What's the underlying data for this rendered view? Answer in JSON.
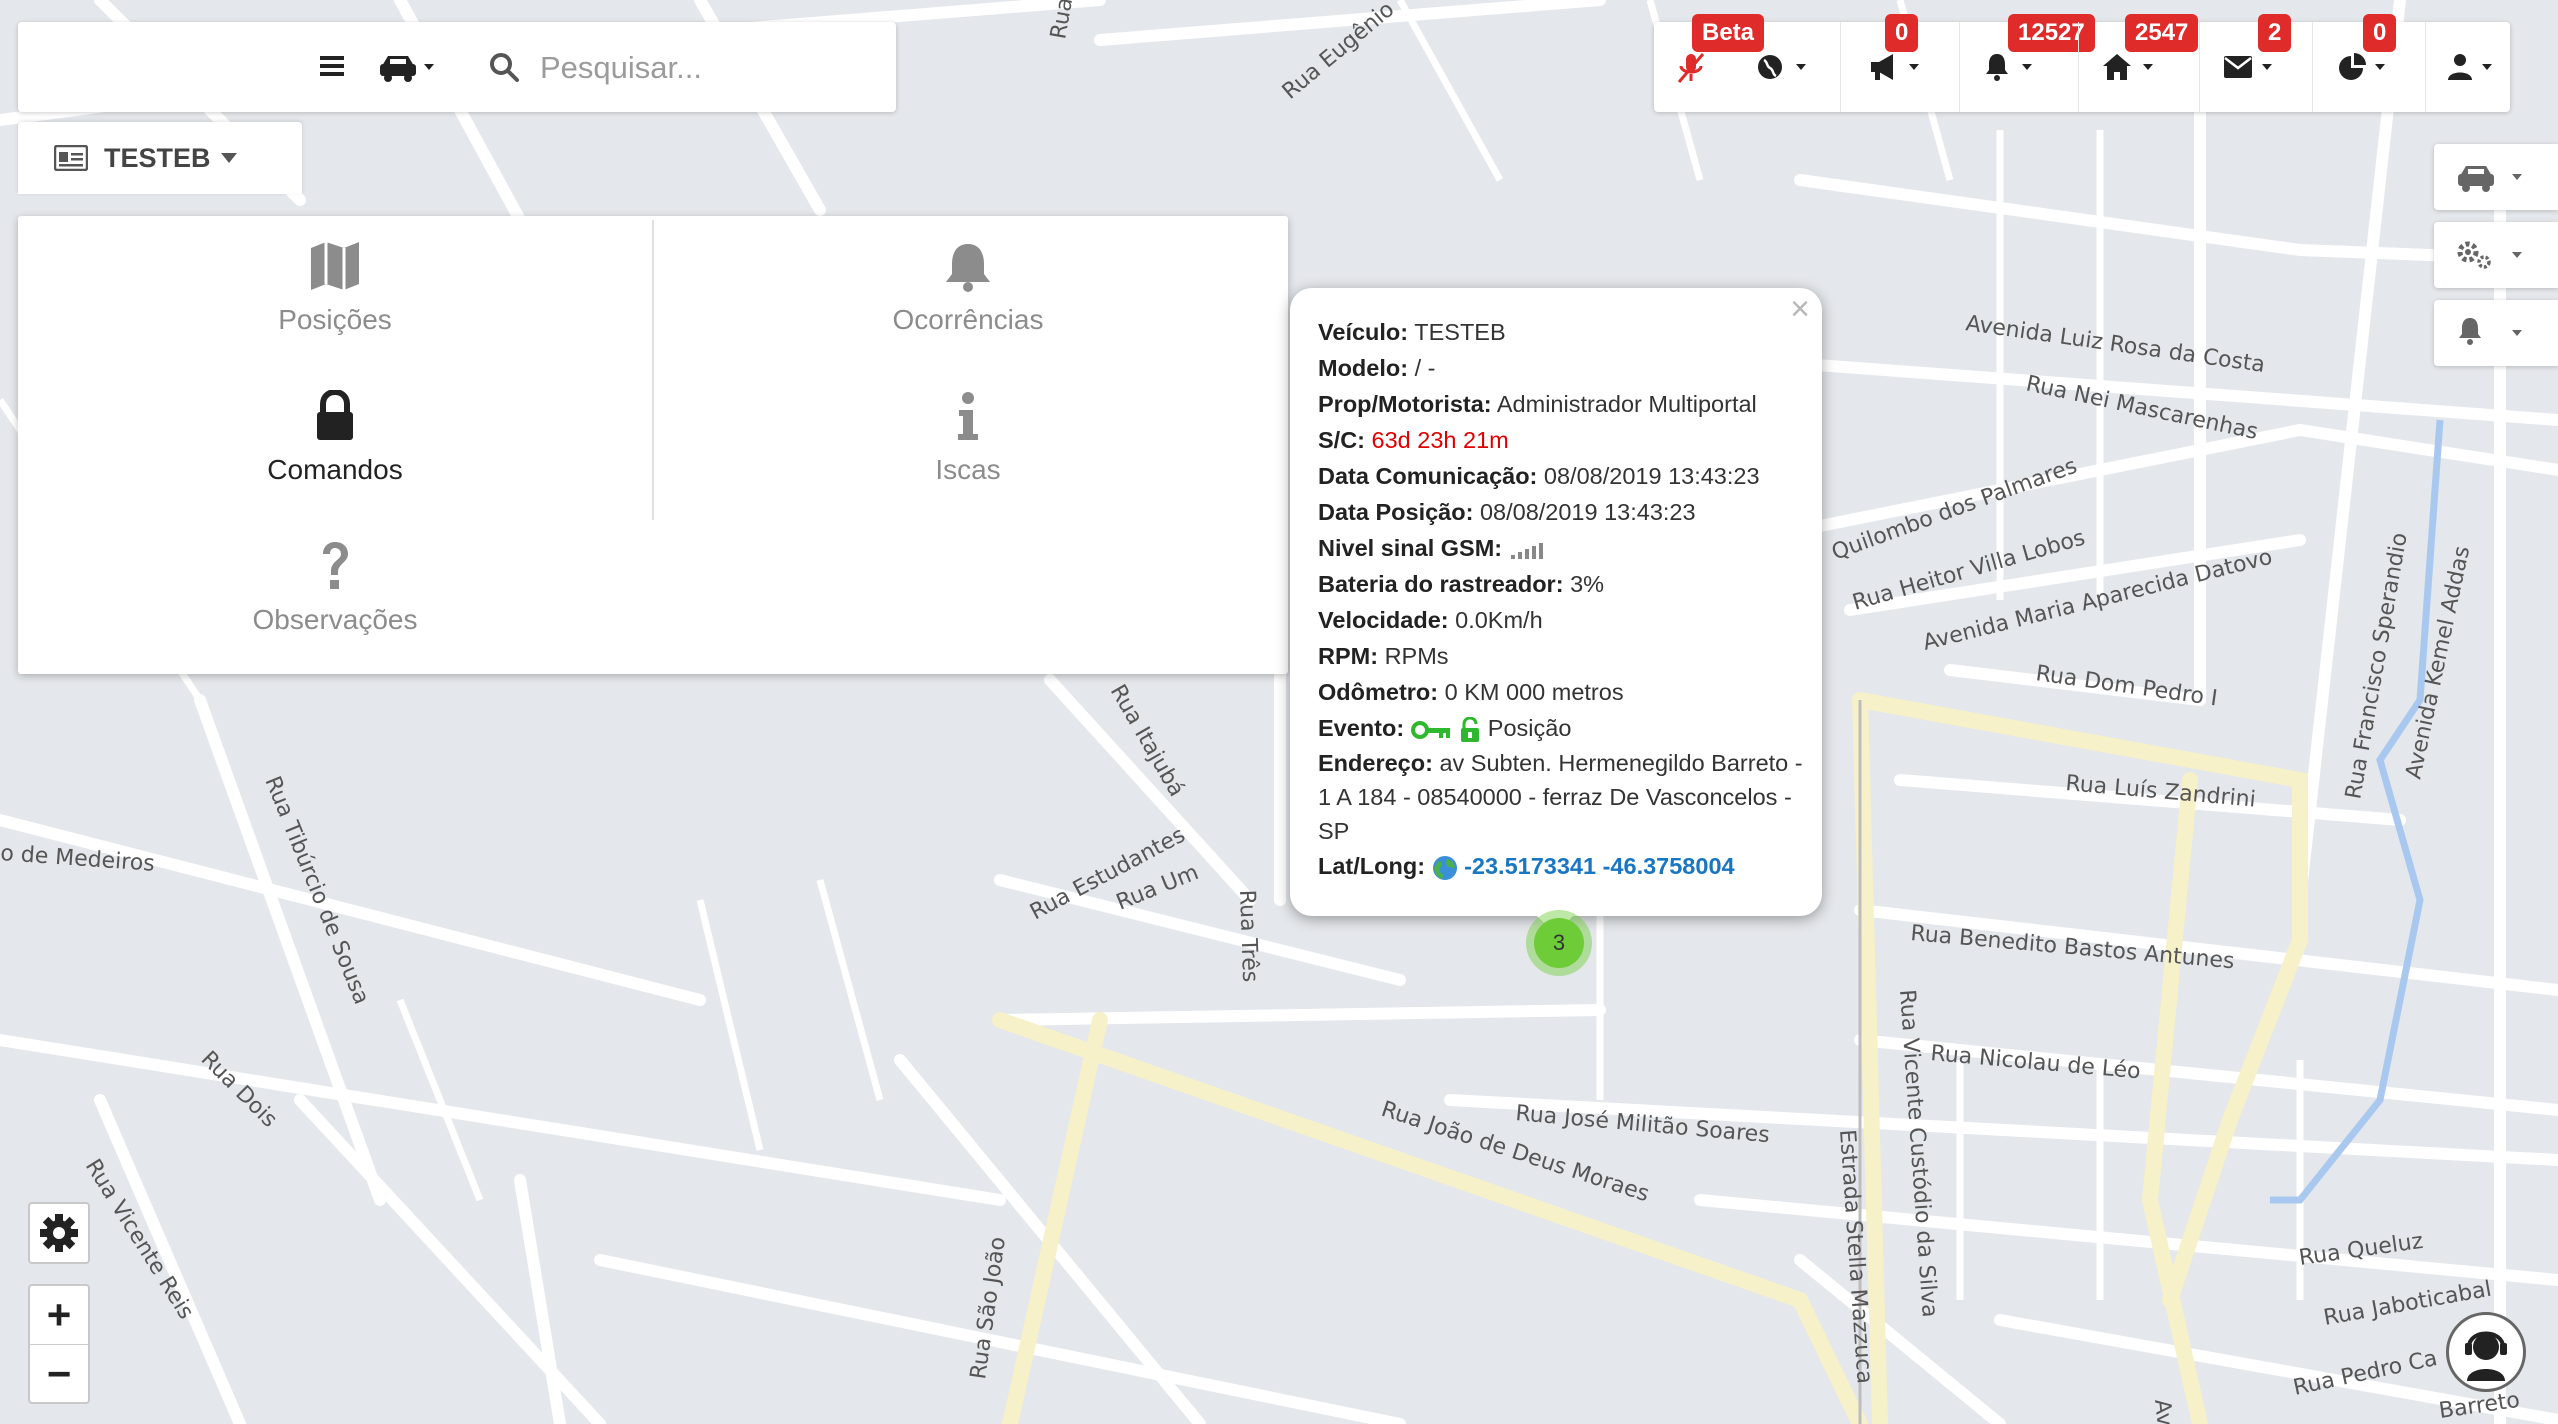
{
  "search": {
    "placeholder": "Pesquisar..."
  },
  "vehicle_tab": {
    "label": "TESTEB"
  },
  "panel": {
    "items": [
      {
        "label": "Posições",
        "icon": "map-icon"
      },
      {
        "label": "Ocorrências",
        "icon": "bell-icon"
      },
      {
        "label": "Comandos",
        "icon": "lock-icon",
        "active": true
      },
      {
        "label": "Iscas",
        "icon": "info-icon"
      },
      {
        "label": "Observações",
        "icon": "question-icon"
      }
    ]
  },
  "toolbar": {
    "beta": "Beta",
    "megaphone_count": "0",
    "alerts_count": "12527",
    "home_count": "2547",
    "mail_count": "2",
    "pie_count": "0"
  },
  "popup": {
    "veiculo_label": "Veículo:",
    "veiculo": "TESTEB",
    "modelo_label": "Modelo:",
    "modelo": "/ -",
    "prop_label": "Prop/Motorista:",
    "prop": "Administrador Multiportal",
    "sc_label": "S/C:",
    "sc": "63d 23h 21m",
    "data_com_label": "Data Comunicação:",
    "data_com": "08/08/2019 13:43:23",
    "data_pos_label": "Data Posição:",
    "data_pos": "08/08/2019 13:43:23",
    "gsm_label": "Nivel sinal GSM:",
    "bateria_label": "Bateria do rastreador:",
    "bateria": "3%",
    "velocidade_label": "Velocidade:",
    "velocidade": "0.0Km/h",
    "rpm_label": "RPM:",
    "rpm": "RPMs",
    "odometro_label": "Odômetro:",
    "odometro": "0 KM 000 metros",
    "evento_label": "Evento:",
    "evento": "Posição",
    "endereco_label": "Endereço:",
    "endereco": "av Subten. Hermenegildo Barreto - 1 A 184 - 08540000 - ferraz De Vasconcelos - SP",
    "latlong_label": "Lat/Long:",
    "latlong": "-23.5173341 -46.3758004",
    "close": "×"
  },
  "cluster": {
    "count": "3"
  },
  "zoom": {
    "in": "+",
    "out": "−"
  },
  "streets": [
    "Rua Eugênio",
    "Rua",
    "Avenida Luiz Rosa da Costa",
    "Rua Nei Mascarenhas",
    "Quilombo dos Palmares",
    "Rua Heitor Villa Lobos",
    "Avenida Maria Aparecida Datovo",
    "Rua Francisco Sperandio",
    "Avenida Kemel Addas",
    "Rua Dom Pedro I",
    "Rua Luís Zandrini",
    "Rua Benedito Bastos Antunes",
    "Rua Nicolau de Léo",
    "Rua José Militão Soares",
    "Rua João de Deus Moraes",
    "Estrada Stella Mazzuca",
    "Rua Vicente Custódio da Silva",
    "Rua Queluz",
    "Rua Jaboticabal",
    "Rua Pedro Ca",
    "Rua Itajubá",
    "Rua Estudantes",
    "Rua Um",
    "Rua Três",
    "Rua Tibúrcio de Sousa",
    "o de Medeiros",
    "Rua Dois",
    "Rua Vicente Reis",
    "Rua São João",
    "Avenida",
    "Barreto"
  ]
}
